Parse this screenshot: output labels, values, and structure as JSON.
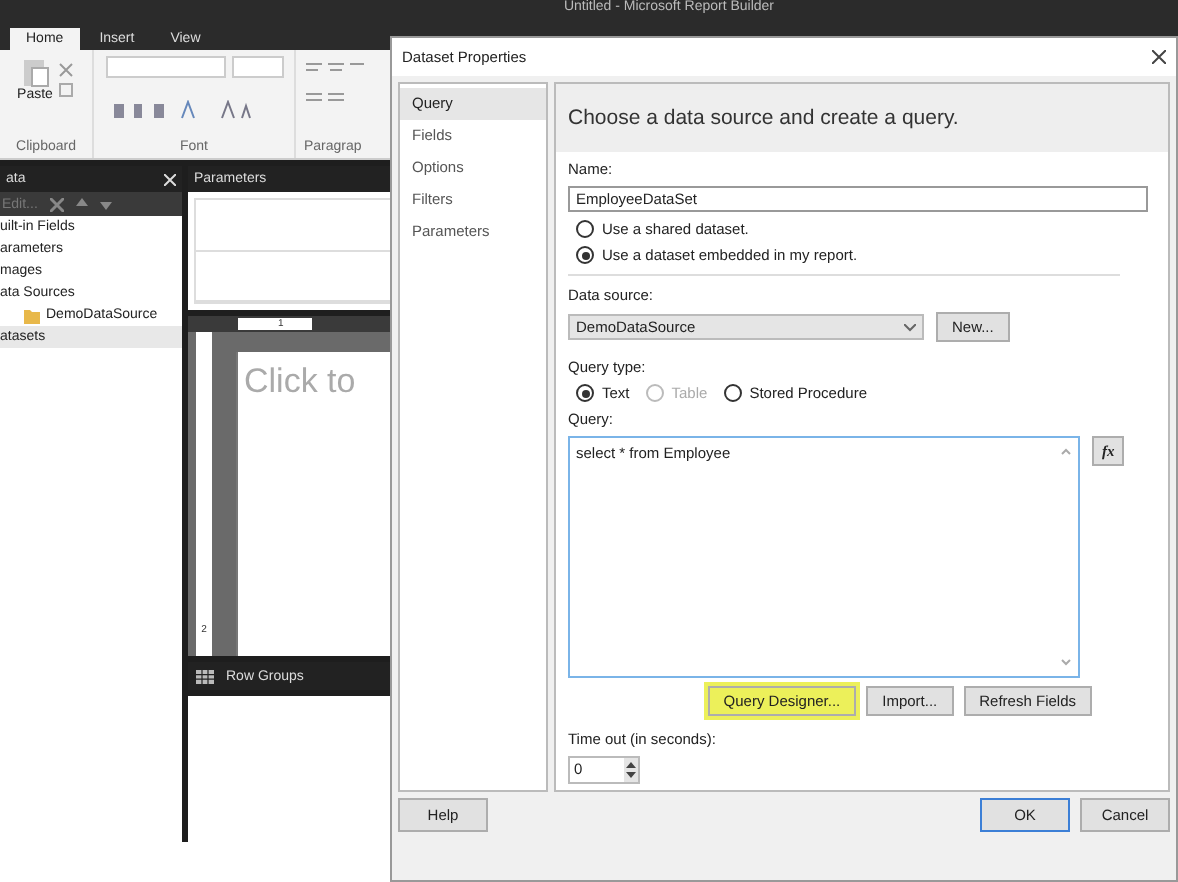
{
  "app": {
    "title": "Untitled - Microsoft Report Builder",
    "ribbon_tabs": [
      {
        "label": "Home",
        "selected": true
      },
      {
        "label": "Insert",
        "selected": false
      },
      {
        "label": "View",
        "selected": false
      }
    ],
    "clipboard": {
      "paste": "Paste",
      "label": "Clipboard"
    },
    "font_group": {
      "label": "Font"
    },
    "paragraph_group": {
      "label": "Paragrap"
    },
    "data_panel": {
      "title": "ata",
      "edit": "Edit...",
      "items": [
        {
          "label": "uilt-in Fields",
          "selected": false
        },
        {
          "label": "arameters",
          "selected": false
        },
        {
          "label": "mages",
          "selected": false
        },
        {
          "label": "ata Sources",
          "selected": false,
          "children": [
            {
              "label": "DemoDataSource",
              "selected": false
            }
          ]
        },
        {
          "label": "atasets",
          "selected": true
        }
      ]
    },
    "parameters_panel": {
      "title": "Parameters"
    },
    "design": {
      "ruler_label": "1",
      "vertical_ruler_label": "2",
      "title_placeholder": "Click to"
    },
    "row_groups": {
      "title": "Row Groups"
    }
  },
  "dialog": {
    "title": "Dataset Properties",
    "nav": [
      {
        "label": "Query",
        "selected": true
      },
      {
        "label": "Fields",
        "selected": false
      },
      {
        "label": "Options",
        "selected": false
      },
      {
        "label": "Filters",
        "selected": false
      },
      {
        "label": "Parameters",
        "selected": false
      }
    ],
    "header": "Choose a data source and create a query.",
    "name_label": "Name:",
    "name_value": "EmployeeDataSet",
    "source_options": [
      {
        "label": "Use a shared dataset.",
        "selected": false
      },
      {
        "label": "Use a dataset embedded in my report.",
        "selected": true
      }
    ],
    "data_source_label": "Data source:",
    "data_source_value": "DemoDataSource",
    "new_button": "New...",
    "query_type_label": "Query type:",
    "query_types": [
      {
        "label": "Text",
        "selected": true,
        "disabled": false
      },
      {
        "label": "Table",
        "selected": false,
        "disabled": true
      },
      {
        "label": "Stored Procedure",
        "selected": false,
        "disabled": false
      }
    ],
    "query_label": "Query:",
    "query_value": "select * from Employee",
    "expression_button": "fx",
    "query_buttons": [
      {
        "label": "Query Designer...",
        "highlighted": true
      },
      {
        "label": "Import...",
        "highlighted": false
      },
      {
        "label": "Refresh Fields",
        "highlighted": false
      }
    ],
    "timeout_label": "Time out (in seconds):",
    "timeout_value": "0",
    "footer": {
      "help": "Help",
      "ok": "OK",
      "cancel": "Cancel"
    }
  }
}
